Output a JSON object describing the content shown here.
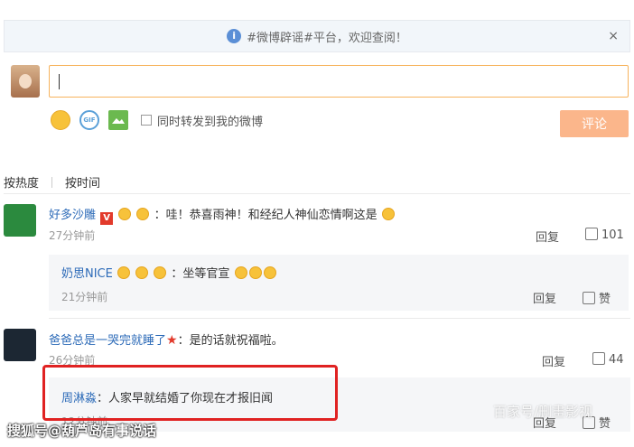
{
  "notice": {
    "text": "#微博辟谣#平台，欢迎查阅！",
    "info_icon": "i",
    "close": "×"
  },
  "composer": {
    "share_label": "同时转发到我的微博",
    "submit_label": "评论",
    "gif_label": "GIF"
  },
  "sort": {
    "hot": "按热度",
    "time": "按时间"
  },
  "comments": [
    {
      "user": "好多沙雕",
      "text": "：哇！恭喜雨神！和经纪人神仙恋情啊这是",
      "time": "27分钟前",
      "reply": "回复",
      "likes": "101",
      "vip": "V",
      "replies": [
        {
          "user": "奶思NICE",
          "text": "：坐等官宣",
          "time": "21分钟前",
          "reply": "回复",
          "like": "赞"
        }
      ]
    },
    {
      "user": "爸爸总是一哭完就睡了",
      "text": "：是的话就祝福啦。",
      "time": "26分钟前",
      "reply": "回复",
      "likes": "44",
      "replies": [
        {
          "user": "周淋淼",
          "text": "：人家早就结婚了你现在才报旧闻",
          "time": "12分钟前",
          "reply": "回复",
          "like": "赞"
        }
      ]
    }
  ],
  "watermarks": {
    "left": "搜狐号@葫芦岛有事说话",
    "right": "百家号/删畫影视"
  },
  "colors": {
    "link": "#2d6bb8",
    "accent": "#f7b35d",
    "submit": "#fbb68b",
    "highlight": "#e02222"
  }
}
